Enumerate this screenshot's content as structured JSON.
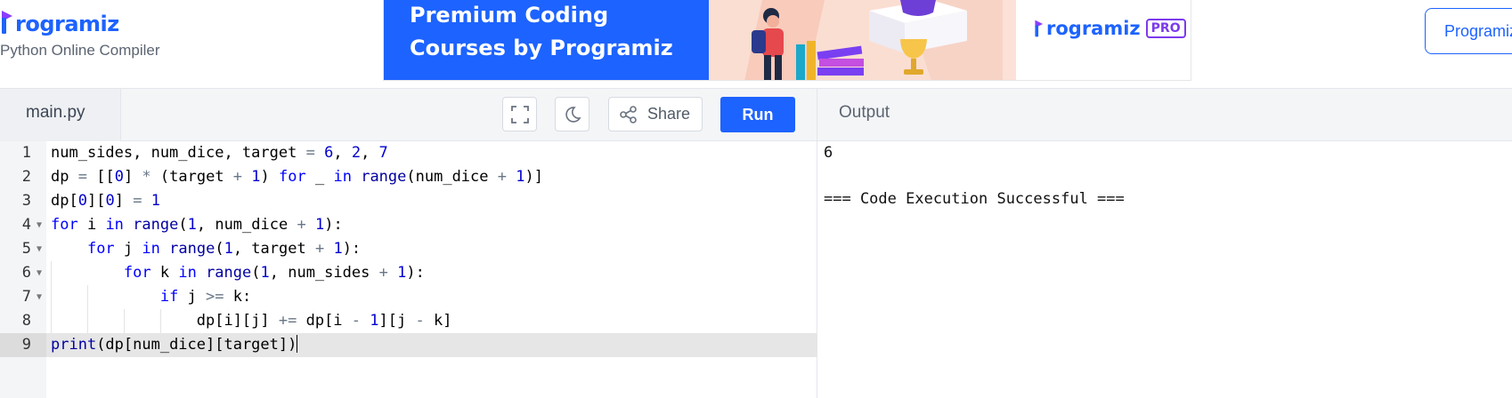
{
  "header": {
    "logo_text": "rogramiz",
    "subtitle": "Python Online Compiler",
    "banner": {
      "line1": "Premium Coding",
      "line2": "Courses by Programiz",
      "brand": "rogramiz",
      "badge": "PRO"
    },
    "right_button": "Programiz"
  },
  "editor": {
    "tab_label": "main.py",
    "share_label": "Share",
    "run_label": "Run",
    "line_numbers": [
      "1",
      "2",
      "3",
      "4",
      "5",
      "6",
      "7",
      "8",
      "9"
    ]
  },
  "output": {
    "title": "Output",
    "lines": [
      "6",
      "",
      "=== Code Execution Successful ==="
    ]
  },
  "colors": {
    "accent": "#1d63ff",
    "pro_badge": "#7c3aed",
    "keyword": "#0000ff",
    "number": "#0000cd"
  },
  "icons": [
    "fullscreen-icon",
    "moon-icon",
    "share-icon"
  ]
}
